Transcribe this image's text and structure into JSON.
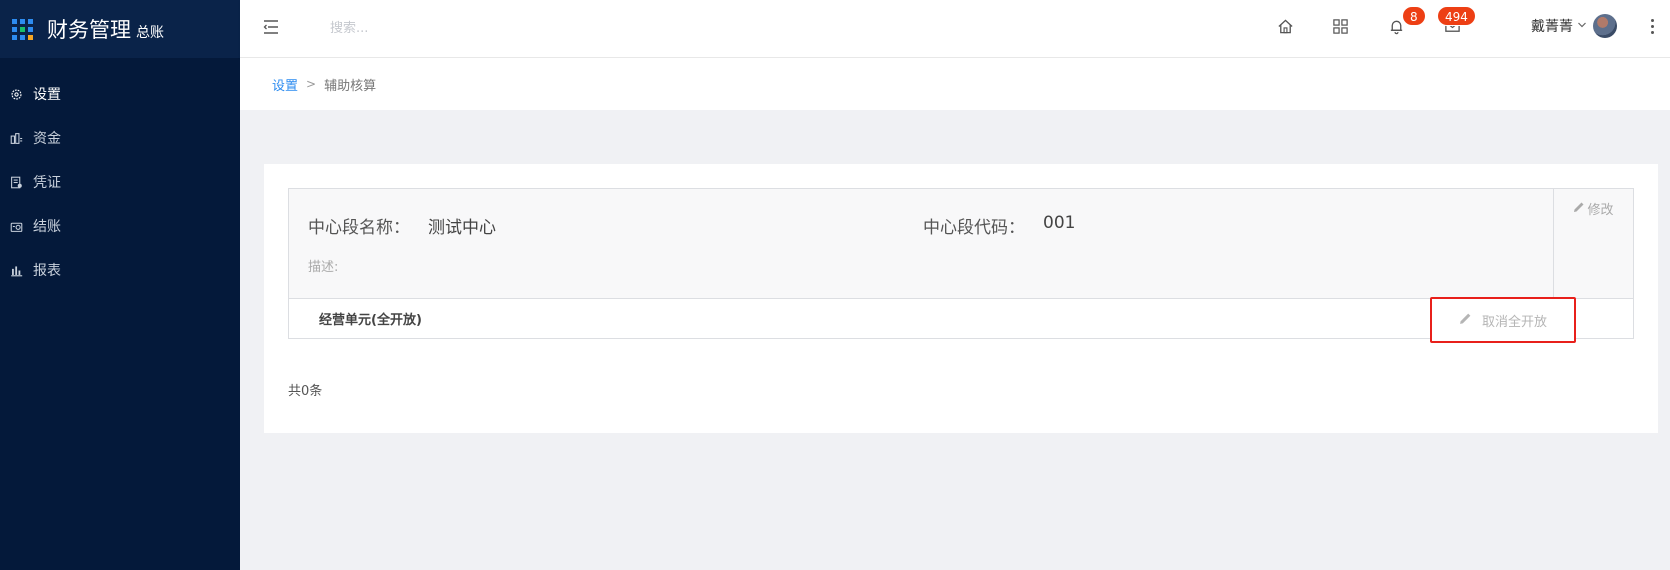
{
  "app": {
    "title": "财务管理",
    "subtitle": "总账"
  },
  "sidebar": {
    "items": [
      {
        "label": "设置",
        "icon": "gear-icon",
        "active": true
      },
      {
        "label": "资金",
        "icon": "funds-icon",
        "active": false
      },
      {
        "label": "凭证",
        "icon": "voucher-icon",
        "active": false
      },
      {
        "label": "结账",
        "icon": "closing-icon",
        "active": false
      },
      {
        "label": "报表",
        "icon": "report-icon",
        "active": false
      }
    ]
  },
  "topbar": {
    "search_placeholder": "搜索...",
    "notifications_count": "8",
    "messages_count": "494",
    "user_name": "戴菁菁"
  },
  "breadcrumb": {
    "parent": "设置",
    "separator": ">",
    "current": "辅助核算"
  },
  "center": {
    "name_label": "中心段名称：",
    "name_value": "测试中心",
    "code_label": "中心段代码：",
    "code_value": "001",
    "desc_label": "描述:",
    "edit_label": "修改"
  },
  "unit": {
    "name": "经营单元(全开放)",
    "cancel_label": "取消全开放"
  },
  "footer": {
    "total": "共0条"
  },
  "colors": {
    "sidebar_bg": "#04193a",
    "accent": "#2d8cf0",
    "badge": "#ed3f14",
    "highlight_border": "#e8201b"
  }
}
